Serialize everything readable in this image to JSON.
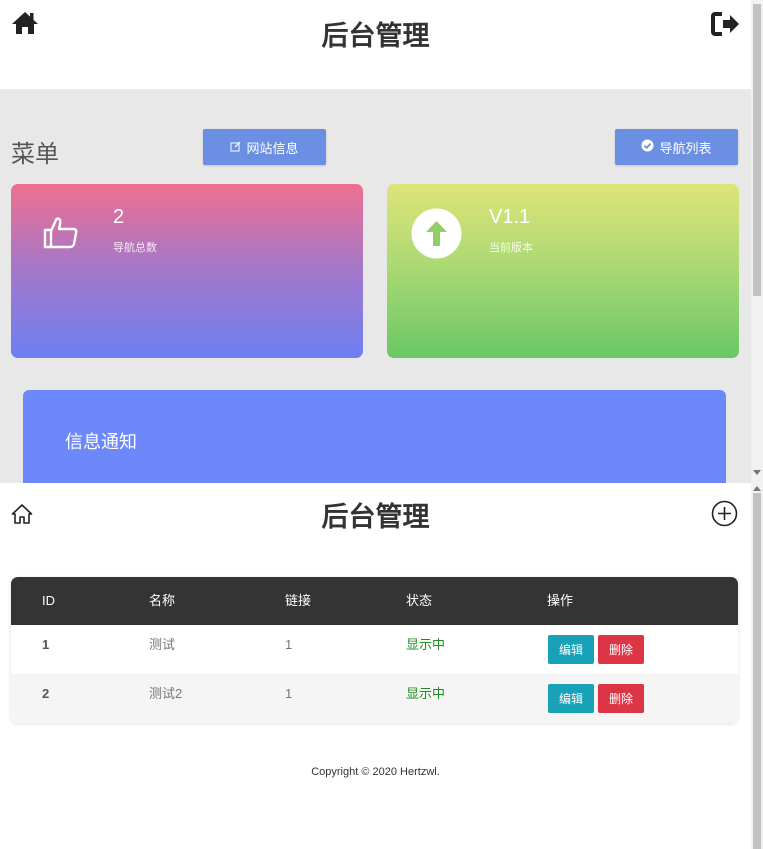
{
  "top": {
    "header": {
      "title": "后台管理",
      "left_icon": "home-icon",
      "right_icon": "logout-icon"
    },
    "menu_label": "菜单",
    "buttons": {
      "site_info": "网站信息",
      "nav_list": "导航列表"
    },
    "cards": [
      {
        "value": "2",
        "label": "导航总数",
        "icon": "thumbs-up-icon"
      },
      {
        "value": "V1.1",
        "label": "当前版本",
        "icon": "arrow-up-icon"
      }
    ],
    "notice": {
      "title": "信息通知"
    }
  },
  "bottom": {
    "header": {
      "title": "后台管理",
      "left_icon": "home-outline-icon",
      "right_icon": "plus-circle-icon"
    },
    "table": {
      "columns": [
        "ID",
        "名称",
        "链接",
        "状态",
        "操作"
      ],
      "rows": [
        {
          "id": "1",
          "name": "测试",
          "link": "1",
          "status": "显示中",
          "edit": "编辑",
          "delete": "删除"
        },
        {
          "id": "2",
          "name": "测试2",
          "link": "1",
          "status": "显示中",
          "edit": "编辑",
          "delete": "删除"
        }
      ]
    },
    "footer": "Copyright © 2020 Hertzwl."
  },
  "colors": {
    "primary_button": "#6b8fe3",
    "card_left_top": "#ef7090",
    "card_left_bottom": "#6d7ff2",
    "card_right_top": "#dfe47a",
    "card_right_bottom": "#6ac766",
    "notice": "#6c88fa",
    "table_header": "#343434",
    "status_green": "#1f8c1f",
    "edit": "#17a2b8",
    "delete": "#dc3545"
  }
}
